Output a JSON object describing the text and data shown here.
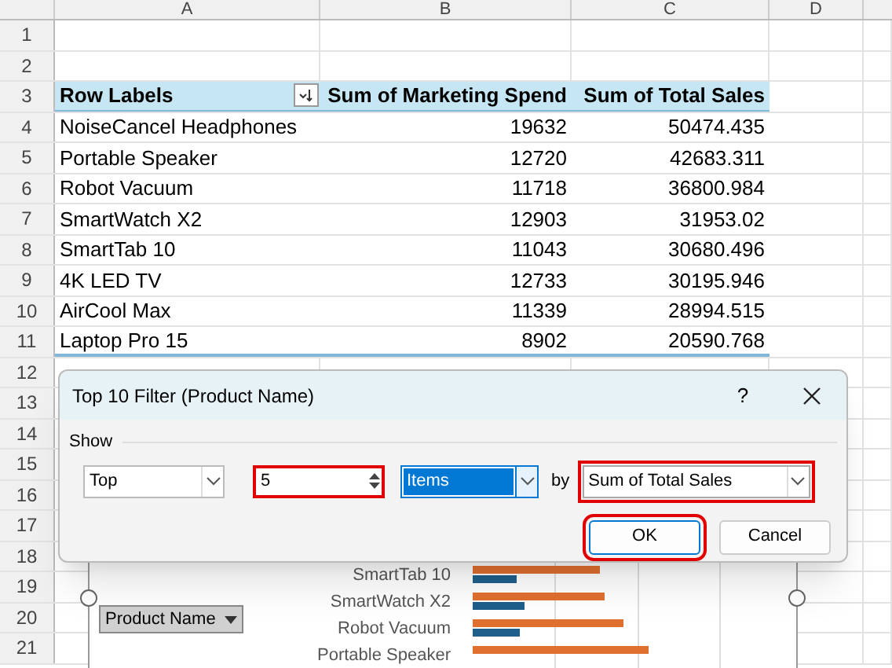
{
  "sheet": {
    "columns": [
      "A",
      "B",
      "C",
      "D"
    ],
    "row_numbers": [
      "1",
      "2",
      "3",
      "4",
      "5",
      "6",
      "7",
      "8",
      "9",
      "10",
      "11",
      "12",
      "13",
      "14",
      "15",
      "16",
      "17",
      "18",
      "19",
      "20",
      "21"
    ],
    "pivot": {
      "headers": [
        "Row Labels",
        "Sum of Marketing Spend",
        "Sum of Total Sales"
      ],
      "rows": [
        [
          "NoiseCancel Headphones",
          "19632",
          "50474.435"
        ],
        [
          "Portable Speaker",
          "12720",
          "42683.311"
        ],
        [
          "Robot Vacuum",
          "11718",
          "36800.984"
        ],
        [
          "SmartWatch X2",
          "12903",
          "31953.02"
        ],
        [
          "SmartTab 10",
          "11043",
          "30680.496"
        ],
        [
          "4K LED TV",
          "12733",
          "30195.946"
        ],
        [
          "AirCool Max",
          "11339",
          "28994.515"
        ],
        [
          "Laptop Pro 15",
          "8902",
          "20590.768"
        ]
      ]
    }
  },
  "chart": {
    "field_button": "Product Name",
    "labels": [
      "SmartTab 10",
      "SmartWatch X2",
      "Robot Vacuum",
      "Portable Speaker"
    ]
  },
  "dialog": {
    "title": "Top 10 Filter (Product Name)",
    "help": "?",
    "group": "Show",
    "controls": [
      {
        "kind": "dropdown",
        "value": "Top",
        "highlighted": false,
        "focused": false
      },
      {
        "kind": "spinner",
        "value": "5",
        "highlighted": true,
        "focused": false
      },
      {
        "kind": "dropdown",
        "value": "Items",
        "highlighted": false,
        "focused": true
      },
      {
        "kind": "label",
        "value": "by"
      },
      {
        "kind": "dropdown",
        "value": "Sum of Total Sales",
        "highlighted": true,
        "focused": false
      }
    ],
    "buttons": [
      {
        "label": "OK",
        "default": true,
        "highlighted": true
      },
      {
        "label": "Cancel",
        "default": false,
        "highlighted": false
      }
    ]
  }
}
